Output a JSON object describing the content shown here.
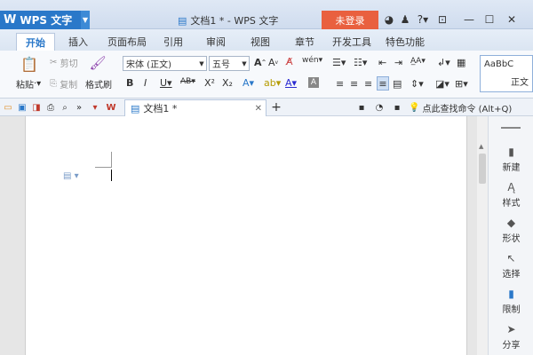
{
  "titlebar": {
    "app_name": "WPS 文字",
    "doc_title": "文档1 * - WPS 文字",
    "login": "未登录",
    "help_glyph": "?"
  },
  "tabs": [
    "开始",
    "插入",
    "页面布局",
    "引用",
    "审阅",
    "视图",
    "章节",
    "开发工具",
    "特色功能"
  ],
  "ribbon": {
    "paste": "粘贴",
    "cut": "剪切",
    "copy": "复制",
    "format_painter": "格式刷",
    "font_name": "宋体 (正文)",
    "font_size": "五号",
    "style_preview": "AaBbC",
    "style_name": "正文"
  },
  "quickbar": {
    "doc_tab": "文档1 *",
    "add_tab": "+",
    "search_cmd": "点此查找命令 (Alt+Q)"
  },
  "sidepanel": [
    "新建",
    "样式",
    "形状",
    "选择",
    "限制",
    "分享"
  ],
  "colors": {
    "accent": "#2a78c9",
    "login": "#e9603f"
  }
}
